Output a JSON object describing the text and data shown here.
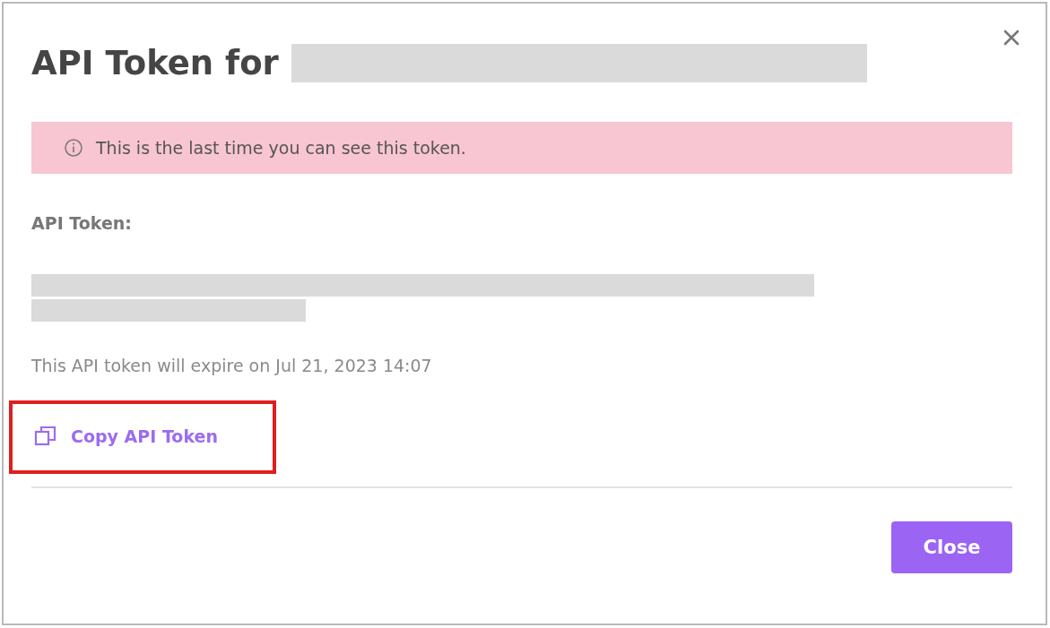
{
  "dialog": {
    "title": "API Token for"
  },
  "alert": {
    "text": "This is the last time you can see this token."
  },
  "token_label": "API Token:",
  "expiry": "This API token will expire on Jul 21, 2023 14:07",
  "copy_link": {
    "label": "Copy API Token",
    "highlighted": true
  },
  "buttons": [
    {
      "label": "Close"
    }
  ]
}
